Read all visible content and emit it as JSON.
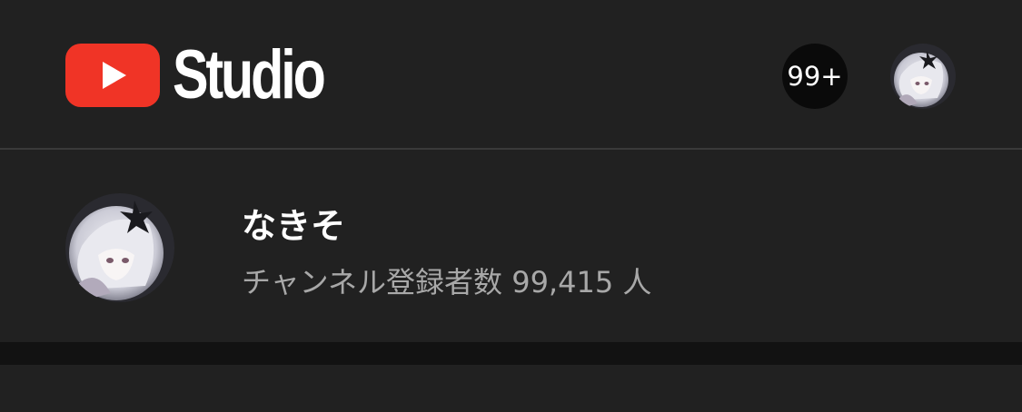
{
  "header": {
    "logo_text": "Studio",
    "notification_count": "99+",
    "icons": {
      "logo": "youtube-play-icon",
      "avatar": "channel-avatar-anime-girl"
    }
  },
  "channel": {
    "name": "なきそ",
    "subscribers": "チャンネル登録者数 99,415 人"
  },
  "colors": {
    "background": "#212121",
    "brand_red": "#f03426",
    "text_primary": "#ffffff",
    "text_secondary": "#a8a8a8",
    "badge_bg": "#0a0a0a",
    "band": "#121212",
    "divider": "#3a3a3a"
  }
}
